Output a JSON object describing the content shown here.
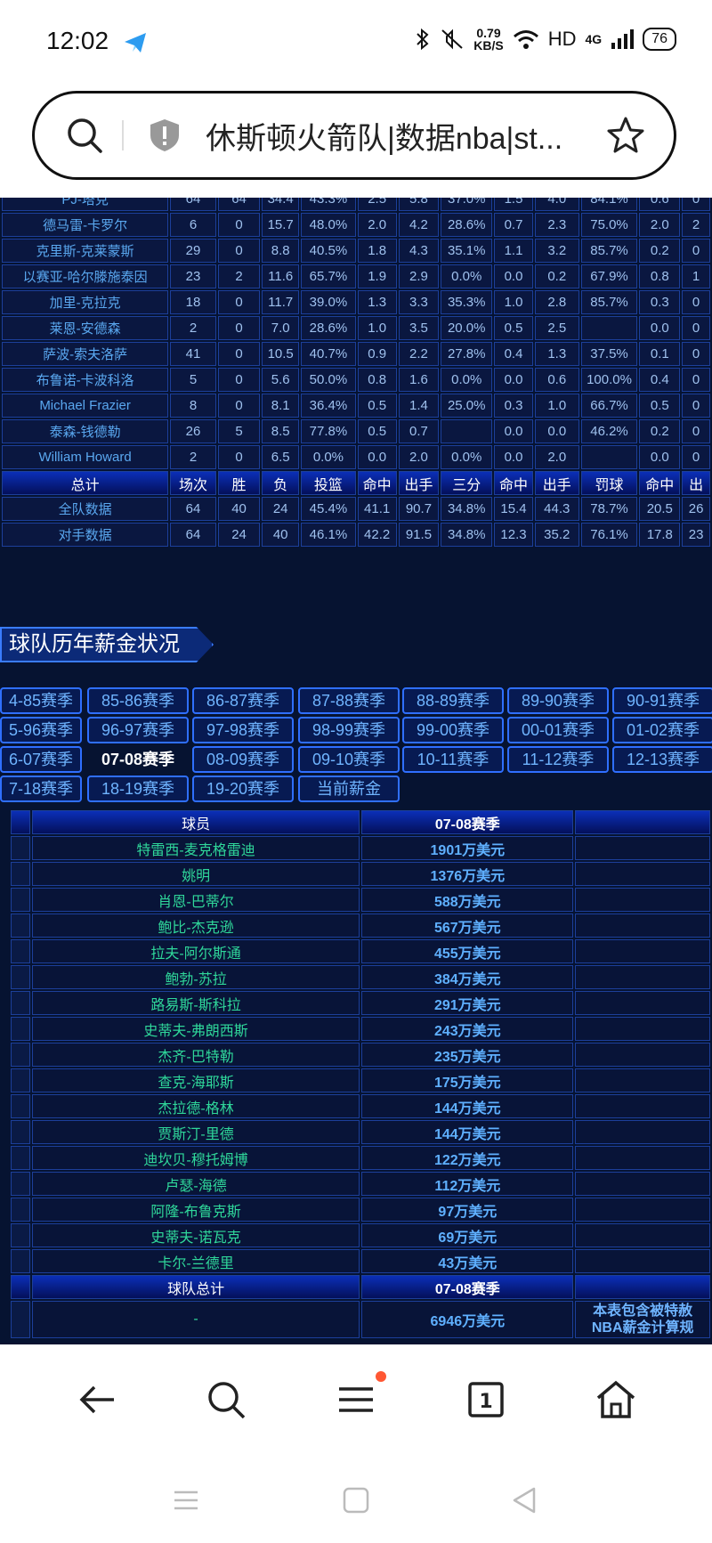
{
  "status_bar": {
    "time": "12:02",
    "net_speed": "0.79",
    "net_unit": "KB/S",
    "hd": "HD",
    "network": "4G",
    "battery": "76"
  },
  "address_bar": {
    "title": "休斯顿火箭队|数据nba|st..."
  },
  "stats": {
    "players": [
      {
        "name": "PJ-塔克",
        "cols": [
          "64",
          "64",
          "34.4",
          "43.3%",
          "2.5",
          "5.8",
          "37.0%",
          "1.5",
          "4.0",
          "84.1%",
          "0.6",
          "0"
        ]
      },
      {
        "name": "德马雷-卡罗尔",
        "cols": [
          "6",
          "0",
          "15.7",
          "48.0%",
          "2.0",
          "4.2",
          "28.6%",
          "0.7",
          "2.3",
          "75.0%",
          "2.0",
          "2"
        ]
      },
      {
        "name": "克里斯-克莱蒙斯",
        "cols": [
          "29",
          "0",
          "8.8",
          "40.5%",
          "1.8",
          "4.3",
          "35.1%",
          "1.1",
          "3.2",
          "85.7%",
          "0.2",
          "0"
        ]
      },
      {
        "name": "以赛亚-哈尔滕施泰因",
        "cols": [
          "23",
          "2",
          "11.6",
          "65.7%",
          "1.9",
          "2.9",
          "0.0%",
          "0.0",
          "0.2",
          "67.9%",
          "0.8",
          "1"
        ]
      },
      {
        "name": "加里-克拉克",
        "cols": [
          "18",
          "0",
          "11.7",
          "39.0%",
          "1.3",
          "3.3",
          "35.3%",
          "1.0",
          "2.8",
          "85.7%",
          "0.3",
          "0"
        ]
      },
      {
        "name": "莱恩-安德森",
        "cols": [
          "2",
          "0",
          "7.0",
          "28.6%",
          "1.0",
          "3.5",
          "20.0%",
          "0.5",
          "2.5",
          "",
          "0.0",
          "0"
        ]
      },
      {
        "name": "萨波-索夫洛萨",
        "cols": [
          "41",
          "0",
          "10.5",
          "40.7%",
          "0.9",
          "2.2",
          "27.8%",
          "0.4",
          "1.3",
          "37.5%",
          "0.1",
          "0"
        ]
      },
      {
        "name": "布鲁诺-卡波科洛",
        "cols": [
          "5",
          "0",
          "5.6",
          "50.0%",
          "0.8",
          "1.6",
          "0.0%",
          "0.0",
          "0.6",
          "100.0%",
          "0.4",
          "0"
        ]
      },
      {
        "name": "Michael Frazier",
        "cols": [
          "8",
          "0",
          "8.1",
          "36.4%",
          "0.5",
          "1.4",
          "25.0%",
          "0.3",
          "1.0",
          "66.7%",
          "0.5",
          "0"
        ]
      },
      {
        "name": "泰森-钱德勒",
        "cols": [
          "26",
          "5",
          "8.5",
          "77.8%",
          "0.5",
          "0.7",
          "",
          "0.0",
          "0.0",
          "46.2%",
          "0.2",
          "0"
        ]
      },
      {
        "name": "William Howard",
        "cols": [
          "2",
          "0",
          "6.5",
          "0.0%",
          "0.0",
          "2.0",
          "0.0%",
          "0.0",
          "2.0",
          "",
          "0.0",
          "0"
        ]
      }
    ],
    "total_header": [
      "总计",
      "场次",
      "胜",
      "负",
      "投篮",
      "命中",
      "出手",
      "三分",
      "命中",
      "出手",
      "罚球",
      "命中",
      "出"
    ],
    "totals": [
      {
        "name": "全队数据",
        "cols": [
          "64",
          "40",
          "24",
          "45.4%",
          "41.1",
          "90.7",
          "34.8%",
          "15.4",
          "44.3",
          "78.7%",
          "20.5",
          "26"
        ]
      },
      {
        "name": "对手数据",
        "cols": [
          "64",
          "24",
          "40",
          "46.1%",
          "42.2",
          "91.5",
          "34.8%",
          "12.3",
          "35.2",
          "76.1%",
          "17.8",
          "23"
        ]
      }
    ]
  },
  "salary_section": {
    "title": "球队历年薪金状况",
    "seasons": [
      [
        "4-85赛季",
        "85-86赛季",
        "86-87赛季",
        "87-88赛季",
        "88-89赛季",
        "89-90赛季",
        "90-91赛季"
      ],
      [
        "5-96赛季",
        "96-97赛季",
        "97-98赛季",
        "98-99赛季",
        "99-00赛季",
        "00-01赛季",
        "01-02赛季"
      ],
      [
        "6-07赛季",
        "07-08赛季",
        "08-09赛季",
        "09-10赛季",
        "10-11赛季",
        "11-12赛季",
        "12-13赛季"
      ],
      [
        "7-18赛季",
        "18-19赛季",
        "19-20赛季",
        "当前薪金"
      ]
    ],
    "active_season": "07-08赛季",
    "table": {
      "header_player": "球员",
      "header_season": "07-08赛季",
      "rows": [
        {
          "player": "特雷西-麦克格雷迪",
          "salary": "1901万美元"
        },
        {
          "player": "姚明",
          "salary": "1376万美元"
        },
        {
          "player": "肖恩-巴蒂尔",
          "salary": "588万美元"
        },
        {
          "player": "鲍比-杰克逊",
          "salary": "567万美元"
        },
        {
          "player": "拉夫-阿尔斯通",
          "salary": "455万美元"
        },
        {
          "player": "鲍勃-苏拉",
          "salary": "384万美元"
        },
        {
          "player": "路易斯-斯科拉",
          "salary": "291万美元"
        },
        {
          "player": "史蒂夫-弗朗西斯",
          "salary": "243万美元"
        },
        {
          "player": "杰齐-巴特勒",
          "salary": "235万美元"
        },
        {
          "player": "查克-海耶斯",
          "salary": "175万美元"
        },
        {
          "player": "杰拉德-格林",
          "salary": "144万美元"
        },
        {
          "player": "贾斯汀-里德",
          "salary": "144万美元"
        },
        {
          "player": "迪坎贝-穆托姆博",
          "salary": "122万美元"
        },
        {
          "player": "卢瑟-海德",
          "salary": "112万美元"
        },
        {
          "player": "阿隆-布鲁克斯",
          "salary": "97万美元"
        },
        {
          "player": "史蒂夫-诺瓦克",
          "salary": "69万美元"
        },
        {
          "player": "卡尔-兰德里",
          "salary": "43万美元"
        }
      ],
      "total_label": "球队总计",
      "total_season": "07-08赛季",
      "total_dash": "-",
      "total_amount": "6946万美元",
      "note_line1": "本表包含被特赦",
      "note_line2": "NBA薪金计算规"
    }
  }
}
